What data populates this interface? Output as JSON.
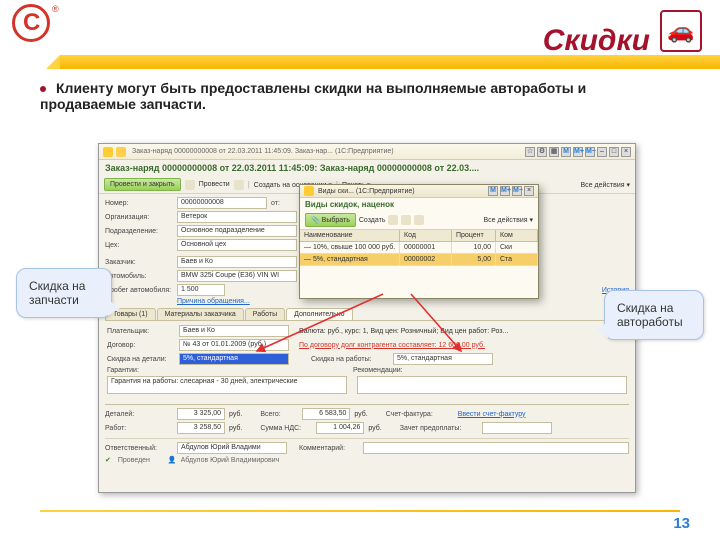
{
  "slide": {
    "title": "Скидки",
    "bullet": "Клиенту могут быть предоставлены скидки на выполняемые автоработы и продаваемые запчасти.",
    "page_number": "13"
  },
  "callouts": {
    "left": "Скидка на запчасти",
    "right": "Скидка на автоработы"
  },
  "app": {
    "window_title": "Заказ-наряд 00000000008 от 22.03.2011 11:45:09. Заказ-нар... (1С:Предприятие)",
    "doc_title": "Заказ-наряд 00000000008 от 22.03.2011 11:45:09: Заказ-наряд 00000000008 от 22.03....",
    "toolbar": {
      "save_close": "Провести и закрыть",
      "post": "Провести",
      "create_basis": "Создать на основании ▾",
      "print": "Печать ▾",
      "all_actions": "Все действия ▾"
    },
    "form": {
      "number_label": "Номер:",
      "number": "00000000008",
      "date_label": "от:",
      "org_label": "Организация:",
      "org": "Ветерок",
      "dept_label": "Подразделение:",
      "dept": "Основное подразделение",
      "shop_label": "Цех:",
      "shop": "Основной цех",
      "customer_label": "Заказчик:",
      "customer": "Баев и Ко",
      "car_label": "Автомобиль:",
      "car": "BMW 325i Coupe (E36) VIN WI",
      "mileage_label": "Пробег автомобиля:",
      "mileage": "1 500",
      "reason_link": "Причина обращения...",
      "history_link": "История"
    },
    "tabs": {
      "goods": "Товары (1)",
      "customer_materials": "Материалы заказчика",
      "works": "Работы",
      "additional": "Дополнительно"
    },
    "additional": {
      "payer_label": "Плательщик:",
      "payer": "Баев и Ко",
      "currency_label": "Валюта: руб., курс: 1, Вид цен: Розничный; Вид цен работ: Роз...",
      "contract_label": "Договор:",
      "contract": "№ 43 от 01.01.2009 (руб.)",
      "debt_link": "По договору долг контрагента составляет: 12 600,00 руб.",
      "disc_parts_label": "Скидка на детали:",
      "disc_parts": "5%, стандартная",
      "disc_works_label": "Скидка на работы:",
      "disc_works": "5%, стандартная",
      "warranty_label": "Гарантии:",
      "warranty": "Гарантия на работы: слесарная - 30 дней, электрические",
      "recom_label": "Рекомендации:"
    },
    "totals": {
      "parts_label": "Деталей:",
      "parts": "3 325,00",
      "cur": "руб.",
      "works_label": "Работ:",
      "works": "3 258,50",
      "total_label": "Всего:",
      "total": "6 583,50",
      "vat_label": "Сумма НДС:",
      "vat": "1 004,26",
      "invoice_label": "Счет-фактура:",
      "invoice_link": "Ввести счет-фактуру",
      "prepay_label": "Зачет предоплаты:"
    },
    "footer": {
      "resp_label": "Ответственный:",
      "resp": "Абдулов Юрий Владими",
      "comment_label": "Комментарий:",
      "posted": "Проведен",
      "author": "Абдулов Юрий Владимирович"
    }
  },
  "popup": {
    "window_title": "Виды ски... (1С:Предприятие)",
    "title": "Виды скидок, наценок",
    "select": "Выбрать",
    "create": "Создать",
    "all_actions": "Все действия ▾",
    "headers": {
      "name": "Наименование",
      "code": "Код",
      "percent": "Процент",
      "col4": "Ком"
    },
    "rows": [
      {
        "name": "10%, свыше 100 000 руб.",
        "code": "00000001",
        "percent": "10,00",
        "c4": "Ски"
      },
      {
        "name": "5%, стандартная",
        "code": "00000002",
        "percent": "5,00",
        "c4": "Ста"
      }
    ]
  }
}
